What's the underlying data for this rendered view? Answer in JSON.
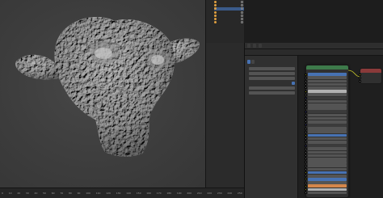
{
  "viewport": {
    "frame_ticks": [
      "0",
      "10",
      "20",
      "30",
      "40",
      "50",
      "60",
      "70",
      "80",
      "90",
      "100",
      "110",
      "120",
      "130",
      "140",
      "150",
      "160",
      "170",
      "180",
      "190",
      "200",
      "210",
      "220",
      "230",
      "240",
      "250"
    ]
  },
  "outliner": {
    "items": [
      "",
      "",
      "",
      "",
      "",
      "",
      ""
    ]
  },
  "shader": {
    "header_chips": [
      "",
      "",
      ""
    ],
    "sidepanel": {
      "title": "",
      "tabs": [
        "",
        ""
      ],
      "rows": [
        "",
        "",
        "",
        "",
        "",
        ""
      ]
    },
    "node": {
      "title": "",
      "output": "",
      "rows": [
        {
          "label": "",
          "style": "blue"
        },
        {
          "label": "",
          "style": ""
        },
        {
          "label": "",
          "style": ""
        },
        {
          "label": "",
          "style": ""
        },
        {
          "label": "",
          "style": ""
        },
        {
          "label": "",
          "style": "color"
        },
        {
          "label": "",
          "style": ""
        },
        {
          "label": "",
          "style": "dark"
        },
        {
          "label": "",
          "style": ""
        },
        {
          "label": "",
          "style": ""
        },
        {
          "label": "",
          "style": ""
        },
        {
          "label": "",
          "style": "dark"
        },
        {
          "label": "",
          "style": ""
        },
        {
          "label": "",
          "style": ""
        },
        {
          "label": "",
          "style": ""
        },
        {
          "label": "",
          "style": "dark"
        },
        {
          "label": "",
          "style": ""
        },
        {
          "label": "",
          "style": ""
        },
        {
          "label": "",
          "style": "blue"
        },
        {
          "label": "",
          "style": ""
        },
        {
          "label": "",
          "style": ""
        },
        {
          "label": "",
          "style": "dark"
        },
        {
          "label": "",
          "style": ""
        },
        {
          "label": "",
          "style": ""
        },
        {
          "label": "",
          "style": ""
        },
        {
          "label": "",
          "style": ""
        },
        {
          "label": "",
          "style": ""
        },
        {
          "label": "",
          "style": ""
        },
        {
          "label": "",
          "style": ""
        },
        {
          "label": "",
          "style": "blue"
        },
        {
          "label": "",
          "style": ""
        },
        {
          "label": "",
          "style": "blue"
        },
        {
          "label": "",
          "style": ""
        },
        {
          "label": "",
          "style": "orange"
        },
        {
          "label": "",
          "style": "color"
        },
        {
          "label": "",
          "style": ""
        }
      ]
    },
    "output_node": {
      "title": "",
      "rows": [
        "",
        "",
        ""
      ]
    }
  },
  "colors": {
    "selection_blue": "#4772b3",
    "node_header_green": "#3d7a4a",
    "output_header_red": "#8a3a3a",
    "socket_yellow": "#c7c729",
    "orange_field": "#d4864a"
  }
}
